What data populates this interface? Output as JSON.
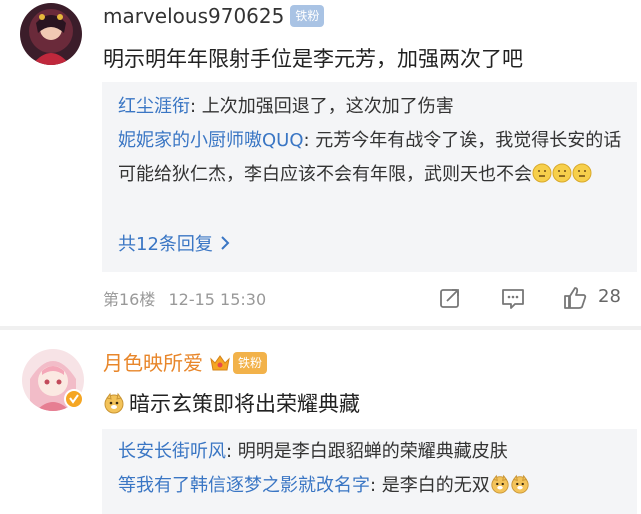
{
  "comment1": {
    "username": "marvelous970625",
    "badge": "铁粉",
    "text": "明示明年年限射手位是李元芳，加强两次了吧",
    "replies": [
      {
        "name": "红尘涯衔",
        "text": ": 上次加强回退了，这次加了伤害"
      },
      {
        "name": "妮妮家的小厨师嗷QUQ",
        "text": ": 元芳今年有战令了诶，我觉得长安的话可能给狄仁杰，李白应该不会有年限，武则天也不会"
      }
    ],
    "more_replies": "共12条回复",
    "floor": "第16楼",
    "time": "12-15 15:30",
    "like_count": "28"
  },
  "comment2": {
    "username": "月色映所爱",
    "badge": "铁粉",
    "text": "暗示玄策即将出荣耀典藏",
    "replies": [
      {
        "name": "长安长街听风",
        "text": ": 明明是李白跟貂蝉的荣耀典藏皮肤"
      },
      {
        "name": "等我有了韩信逐梦之影就改名字",
        "text": ": 是李白的无双"
      }
    ]
  },
  "colors": {
    "link_blue": "#3a76c4",
    "username_orange": "#e8862a",
    "badge_blue": "#a9c3e4",
    "badge_orange": "#f2b24a"
  }
}
